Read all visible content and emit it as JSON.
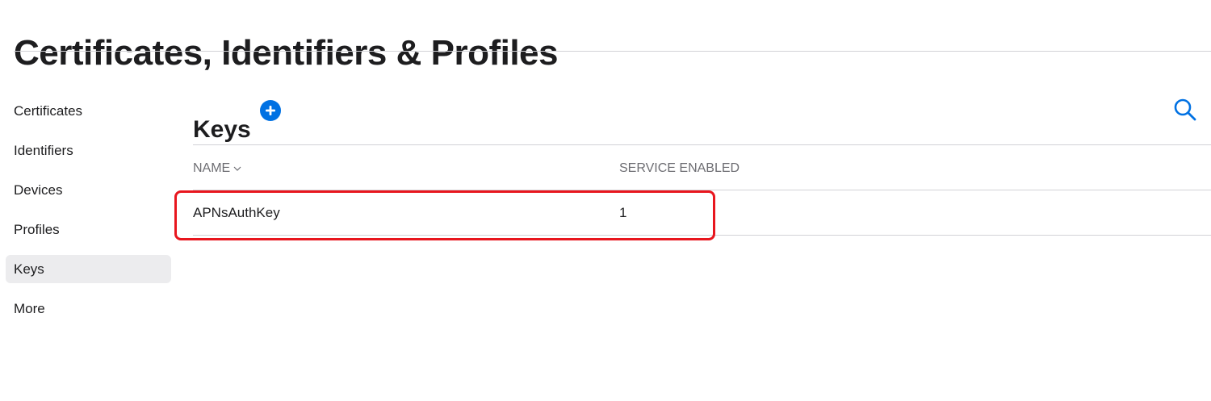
{
  "header": {
    "title": "Certificates, Identifiers & Profiles"
  },
  "sidebar": {
    "items": [
      {
        "label": "Certificates",
        "active": false
      },
      {
        "label": "Identifiers",
        "active": false
      },
      {
        "label": "Devices",
        "active": false
      },
      {
        "label": "Profiles",
        "active": false
      },
      {
        "label": "Keys",
        "active": true
      },
      {
        "label": "More",
        "active": false
      }
    ]
  },
  "main": {
    "title": "Keys",
    "icons": {
      "add": "plus-circle-icon",
      "search": "search-icon",
      "sort": "chevron-down-icon"
    },
    "table": {
      "columns": [
        "NAME",
        "SERVICE ENABLED"
      ],
      "rows": [
        {
          "name": "APNsAuthKey",
          "service_enabled": "1"
        }
      ]
    }
  },
  "colors": {
    "accent": "#0071e3",
    "highlight": "#e8161e",
    "active_background": "#ececee",
    "divider": "#d2d2d7"
  }
}
